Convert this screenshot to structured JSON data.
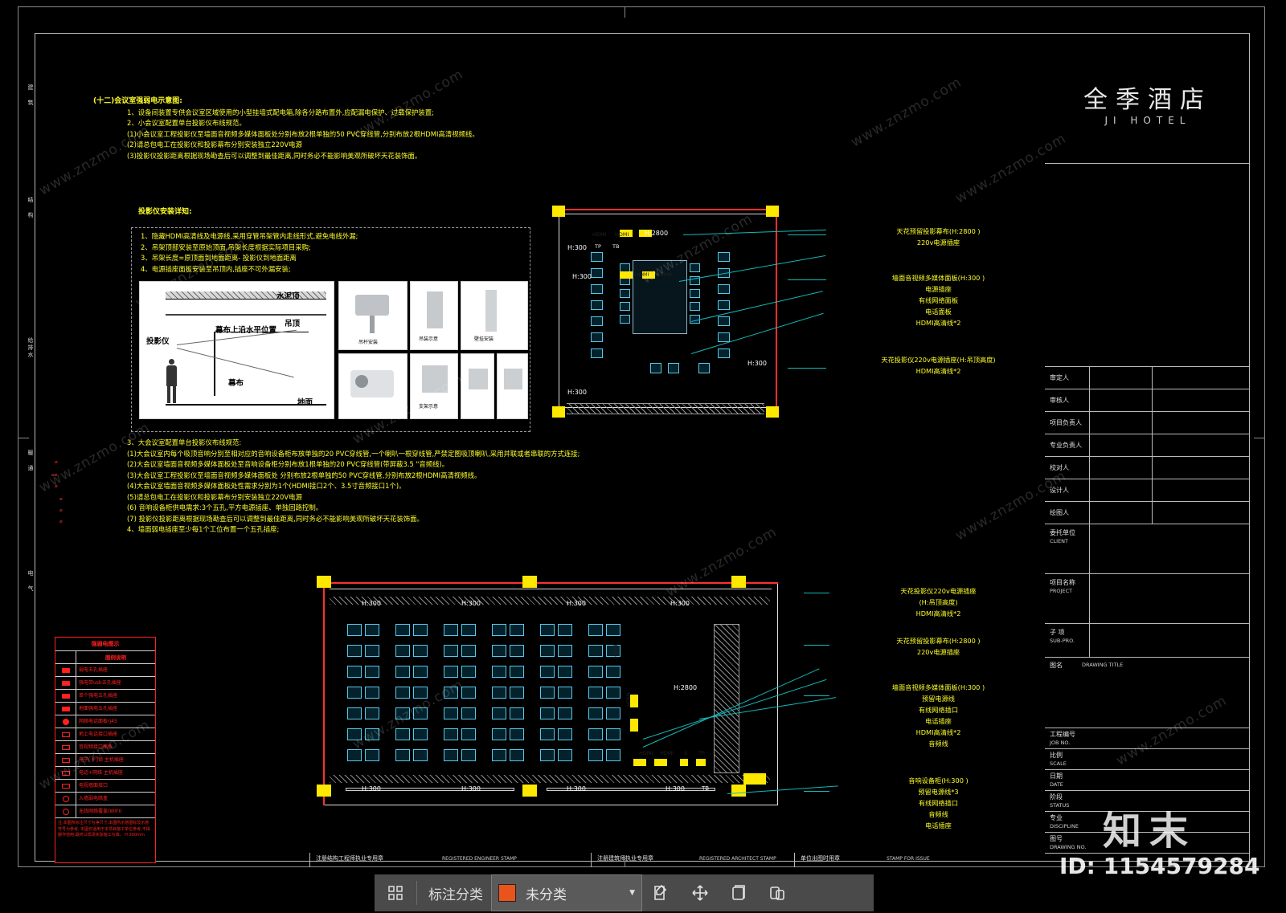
{
  "sheet": {
    "margin_tabs": [
      "建 筑",
      "结 构",
      "给排水",
      "暖 通",
      "电 气"
    ]
  },
  "notes": {
    "section_title": "(十二)会议室强弱电示意图:",
    "lines": [
      "1、设备间装置专供会议室区域使用的小型挂墙式配电箱,除各分路布置外,应配漏电保护、过载保护装置;",
      "2、小会议室配置单台投影仪布线规范。",
      "(1)小会议室工程投影仪至墙面音视频多媒体面板处分别布放2根单独的50  PVC穿线管,分别布放2根HDMI高清视频线。",
      "(2)请总包电工在投影仪和投影幕布分别安装独立220V电源",
      "(3)投影仪投影距离根据现场勘查后可以调整到最佳距离,同时务必不能影响美观所破坏天花装饰面。"
    ]
  },
  "install_detail": {
    "title": "投影仪安装详知:",
    "lines": [
      "1、隐藏HDMI高清线及电源线,采用穿管吊架管内走线形式,避免电线外漏;",
      "2、吊架顶部安装至原始顶面,吊架长度根据实际项目采购;",
      "3、吊架长度=原顶面到地面距离- 投影仪到地面距离",
      "4、电源插座面板安装至吊顶内,插座不可外漏安装;"
    ]
  },
  "illustration": {
    "ceiling_label": "水泥顶",
    "drop_ceiling_label": "吊顶",
    "projector_label": "投影仪",
    "screen_top_label": "幕布上沿水平位置",
    "screen_label": "幕布",
    "ground_label": "地面",
    "small_captions": [
      "吊杆安装",
      "吊装示意",
      "壁挂安装",
      "支架示意"
    ]
  },
  "notes2": {
    "lines": [
      "3、大会议室配置单台投影仪布线规范:",
      "(1)大会议室内每个吸顶音响分别至相对应的音响设备柜布放单独的20  PVC穿线管,一个喇叭一根穿线管,严禁定图吸顶喇叭,采用并联或者串联的方式连接;",
      "(2)大会议室墙面音视频多媒体面板处至音响设备柜分别布放1根单独的20  PVC穿线管(带屏蔽3.5 \"音频线)。",
      "(3)大会议室工程投影仪至墙面音视频多媒体面板处 分别布放2根单独的50  PVC穿线管,分别布放2根HDMI高清视频线。",
      "(4)大会议室墙面音视频多媒体面板处性需求分别为1个(HDMI接口2个、3.5寸音频接口1个)。",
      "(5)请总包电工在投影仪和投影幕布分别安装独立220V电源",
      "(6)  音响设备柜供电需求:3个五孔,平方电源插座、单独回路控制。",
      "(7)  投影仪投影距离根据现场勘查后可以调整到最佳距离,同时务必不能影响美观所破坏天花装饰面。",
      "4、墙面弱电插座至少每1个工位布置一个五孔插座;"
    ]
  },
  "legend": {
    "title": "强弱电图示",
    "col_symbol": "图例",
    "col_desc": "图例说明",
    "rows": [
      {
        "symbol": "box-fill",
        "desc": "弱电五孔插座"
      },
      {
        "symbol": "box-fill",
        "desc": "强电带usb五孔插座"
      },
      {
        "symbol": "box-fill",
        "desc": "单个强电五孔插座"
      },
      {
        "symbol": "box-fill",
        "desc": "地面强电五孔插座"
      },
      {
        "symbol": "circ-fill",
        "desc": "网络电话面板rj45"
      },
      {
        "symbol": "box-open",
        "desc": "地上电话接口插座"
      },
      {
        "symbol": "box-open",
        "desc": "音视频接口面板"
      },
      {
        "symbol": "box-open",
        "desc": "电子门门锁 主机插座"
      },
      {
        "symbol": "box-open",
        "desc": "电话+网络 主机插座"
      },
      {
        "symbol": "box-open",
        "desc": "电视墙面接口"
      },
      {
        "symbol": "circ-open",
        "desc": "入墙弱电暗盒"
      },
      {
        "symbol": "circ-open",
        "desc": "无线网络覆盖(WIFI)"
      }
    ],
    "note": "注:本图所标注尺寸为净尺寸,本图所示意图标及示意符号为参考,\n本图仅适用于本项目施工单位参考,不得挪作他用,最终以现场实际施工为准。\nH:300mm"
  },
  "plan_top": {
    "h_tags": [
      "H:2800",
      "H:300",
      "H:300",
      "H:300",
      "H:300"
    ],
    "dev_tags": [
      "HDMI",
      "HDMI",
      "HDMI",
      "HDMI",
      "TP",
      "TB"
    ]
  },
  "plan_bottom": {
    "h_tags_top": [
      "H:300",
      "H:300",
      "H:300",
      "H:300"
    ],
    "h_tags_bottom": [
      "H:300",
      "H:300",
      "H:300",
      "H:300",
      "TB"
    ],
    "h_2800": "H:2800",
    "dev_tags": [
      "HDMI",
      "HDMI",
      "S",
      "TP",
      "HDMI",
      "HDMI"
    ]
  },
  "callouts_top": [
    [
      "天花预留投影幕布(H:2800 )",
      "220v电源插座"
    ],
    [
      "墙面音视频多媒体面板(H:300 )",
      "电源插座",
      "有线网络面板",
      "电话面板",
      "HDMI高清线*2"
    ],
    [
      "天花投影仪220v电源插座(H:吊顶高度)",
      "HDMI高清线*2"
    ]
  ],
  "callouts_bottom": [
    [
      "天花投影仪220v电源插座",
      "(H:吊顶高度)",
      "HDMI高清线*2"
    ],
    [
      "天花预留投影幕布(H:2800 )",
      "220v电源插座"
    ],
    [
      "墙面音视频多媒体面板(H:300 )",
      "预留电源线",
      "有线网络插口",
      "电话插座",
      "HDMI高清线*2",
      "音频线"
    ],
    [
      "音响设备柜(H:300 )",
      "预留电源线*3",
      "有线网络插口",
      "音频线",
      "电话插座"
    ]
  ],
  "title_block": {
    "logo_cn": "全季酒店",
    "logo_en": "JI HOTEL",
    "sign_rows": [
      {
        "label": "审定人"
      },
      {
        "label": "审核人"
      },
      {
        "label": "项目负责人"
      },
      {
        "label": "专业负责人"
      },
      {
        "label": "校对人"
      },
      {
        "label": "设计人"
      },
      {
        "label": "绘图人"
      }
    ],
    "blocks": [
      {
        "cn": "委托单位",
        "en": "CLIENT"
      },
      {
        "cn": "项目名称",
        "en": "PROJECT"
      },
      {
        "cn": "子 项",
        "en": "SUB-PRO."
      }
    ],
    "drawing_title": {
      "cn": "图名",
      "en": "DRAWING TITLE"
    },
    "fields": [
      {
        "cn": "工程编号",
        "en": "JOB NO."
      },
      {
        "cn": "比例",
        "en": "SCALE"
      },
      {
        "cn": "日期",
        "en": "DATE"
      },
      {
        "cn": "阶段",
        "en": "STATUS"
      },
      {
        "cn": "专业",
        "en": "DISCIPLINE"
      },
      {
        "cn": "图号",
        "en": "DRAWING NO."
      }
    ]
  },
  "stamps": [
    {
      "cn": "注册结构工程师执业专用章",
      "en": "REGISTERED ENGINEER STAMP"
    },
    {
      "cn": "注册建筑师执业专用章",
      "en": "REGISTERED ARCHITECT STAMP"
    },
    {
      "cn": "单位出图时用章",
      "en": "STAMP FOR ISSUE"
    }
  ],
  "watermarks": {
    "text": "www.znzmo.com",
    "brand_cn": "知末",
    "id": "ID: 1154579284"
  },
  "toolbar": {
    "grid_icon": "grid-icon",
    "label": "标注分类",
    "swatch_color": "#e8541c",
    "selected": "未分类",
    "caret": "▼",
    "actions": [
      "edit-icon",
      "move-icon",
      "copy-icon",
      "paste-icon"
    ]
  }
}
